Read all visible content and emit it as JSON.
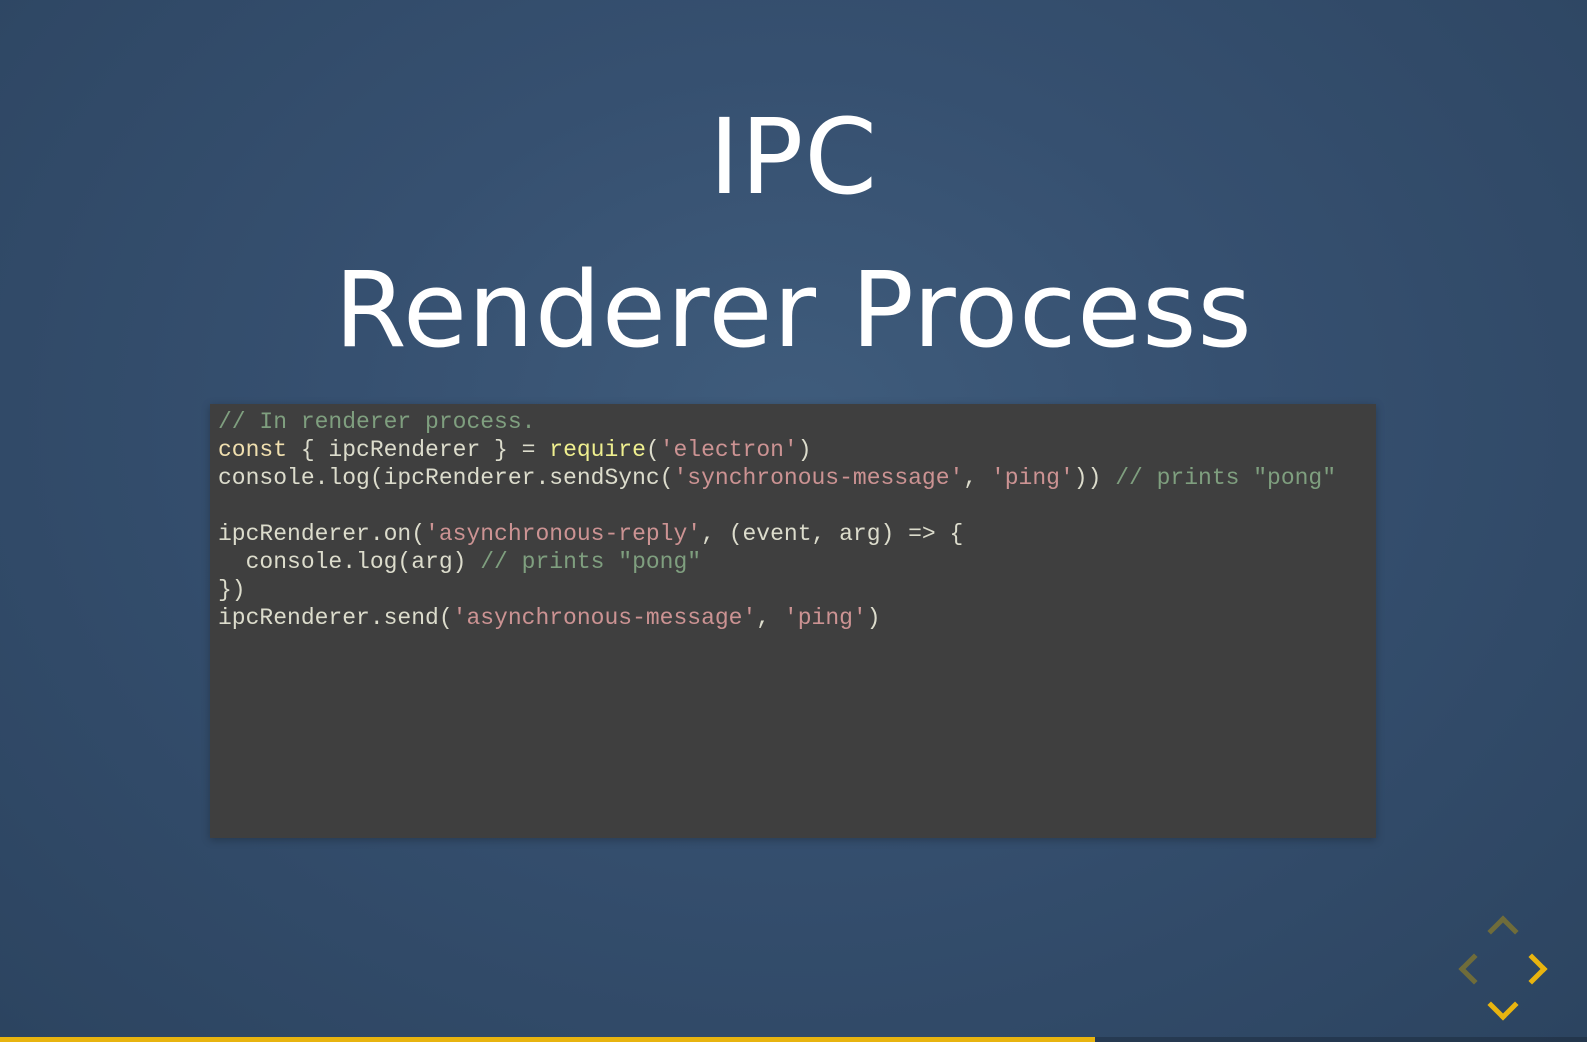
{
  "slide": {
    "title_line_1": "IPC",
    "title_line_2": "Renderer Process"
  },
  "code": {
    "language": "javascript",
    "lines": [
      [
        {
          "t": "comment",
          "v": "// In renderer process."
        }
      ],
      [
        {
          "t": "keyword",
          "v": "const"
        },
        {
          "t": "plain",
          "v": " { ipcRenderer } = "
        },
        {
          "t": "func",
          "v": "require"
        },
        {
          "t": "plain",
          "v": "("
        },
        {
          "t": "string",
          "v": "'electron'"
        },
        {
          "t": "plain",
          "v": ")"
        }
      ],
      [
        {
          "t": "plain",
          "v": "console.log(ipcRenderer.sendSync("
        },
        {
          "t": "string",
          "v": "'synchronous-message'"
        },
        {
          "t": "plain",
          "v": ", "
        },
        {
          "t": "string",
          "v": "'ping'"
        },
        {
          "t": "plain",
          "v": ")) "
        },
        {
          "t": "comment",
          "v": "// prints \"pong\""
        }
      ],
      [],
      [
        {
          "t": "plain",
          "v": "ipcRenderer.on("
        },
        {
          "t": "string",
          "v": "'asynchronous-reply'"
        },
        {
          "t": "plain",
          "v": ", (event, arg) => {"
        }
      ],
      [
        {
          "t": "plain",
          "v": "  console.log(arg) "
        },
        {
          "t": "comment",
          "v": "// prints \"pong\""
        }
      ],
      [
        {
          "t": "plain",
          "v": "})"
        }
      ],
      [
        {
          "t": "plain",
          "v": "ipcRenderer.send("
        },
        {
          "t": "string",
          "v": "'asynchronous-message'"
        },
        {
          "t": "plain",
          "v": ", "
        },
        {
          "t": "string",
          "v": "'ping'"
        },
        {
          "t": "plain",
          "v": ")"
        }
      ]
    ]
  },
  "navigation": {
    "icons": [
      "up-arrow-icon",
      "left-arrow-icon",
      "right-arrow-icon",
      "down-arrow-icon"
    ],
    "enabled": {
      "up": false,
      "left": false,
      "right": true,
      "down": true
    },
    "colors": {
      "enabled": "#e8b40f",
      "disabled": "#6f6c3a"
    }
  },
  "progress": {
    "fraction": 0.69,
    "color": "#e8b40f"
  }
}
